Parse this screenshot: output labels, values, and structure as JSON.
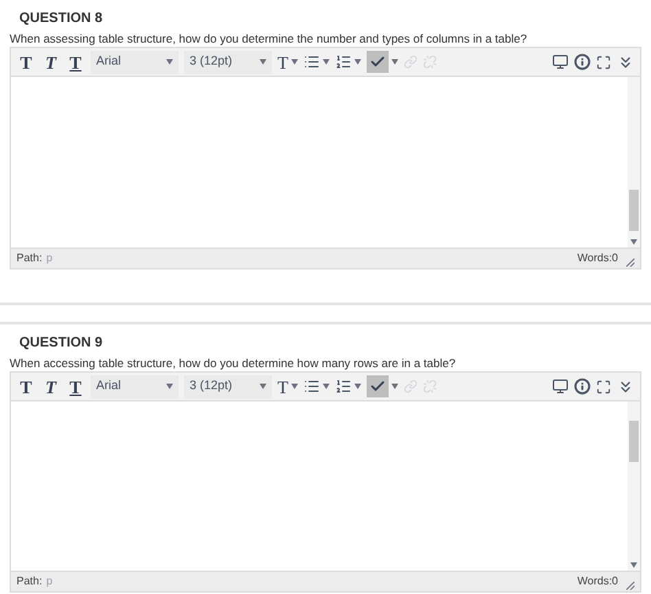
{
  "questions": [
    {
      "title": "QUESTION 8",
      "prompt": "When assessing table structure, how do you determine the number and types of columns in a table?",
      "toolbar": {
        "format_buttons": [
          {
            "kind": "bold",
            "label": "T"
          },
          {
            "kind": "italic",
            "label": "T"
          },
          {
            "kind": "underline",
            "label": "T"
          }
        ],
        "font": "Arial",
        "size": "3 (12pt)",
        "text_color_label": "T",
        "spellcheck_on": true,
        "links_disabled": true
      },
      "status": {
        "path_label": "Path:",
        "path": "p",
        "words": "Words:0"
      }
    },
    {
      "title": "QUESTION 9",
      "prompt": "When accessing table structure, how do you determine how many rows are in a table?",
      "toolbar": {
        "format_buttons": [
          {
            "kind": "bold",
            "label": "T"
          },
          {
            "kind": "italic",
            "label": "T"
          },
          {
            "kind": "underline",
            "label": "T"
          }
        ],
        "font": "Arial",
        "size": "3 (12pt)",
        "text_color_label": "T",
        "spellcheck_on": true,
        "links_disabled": true
      },
      "status": {
        "path_label": "Path:",
        "path": "p",
        "words": "Words:0"
      }
    }
  ]
}
